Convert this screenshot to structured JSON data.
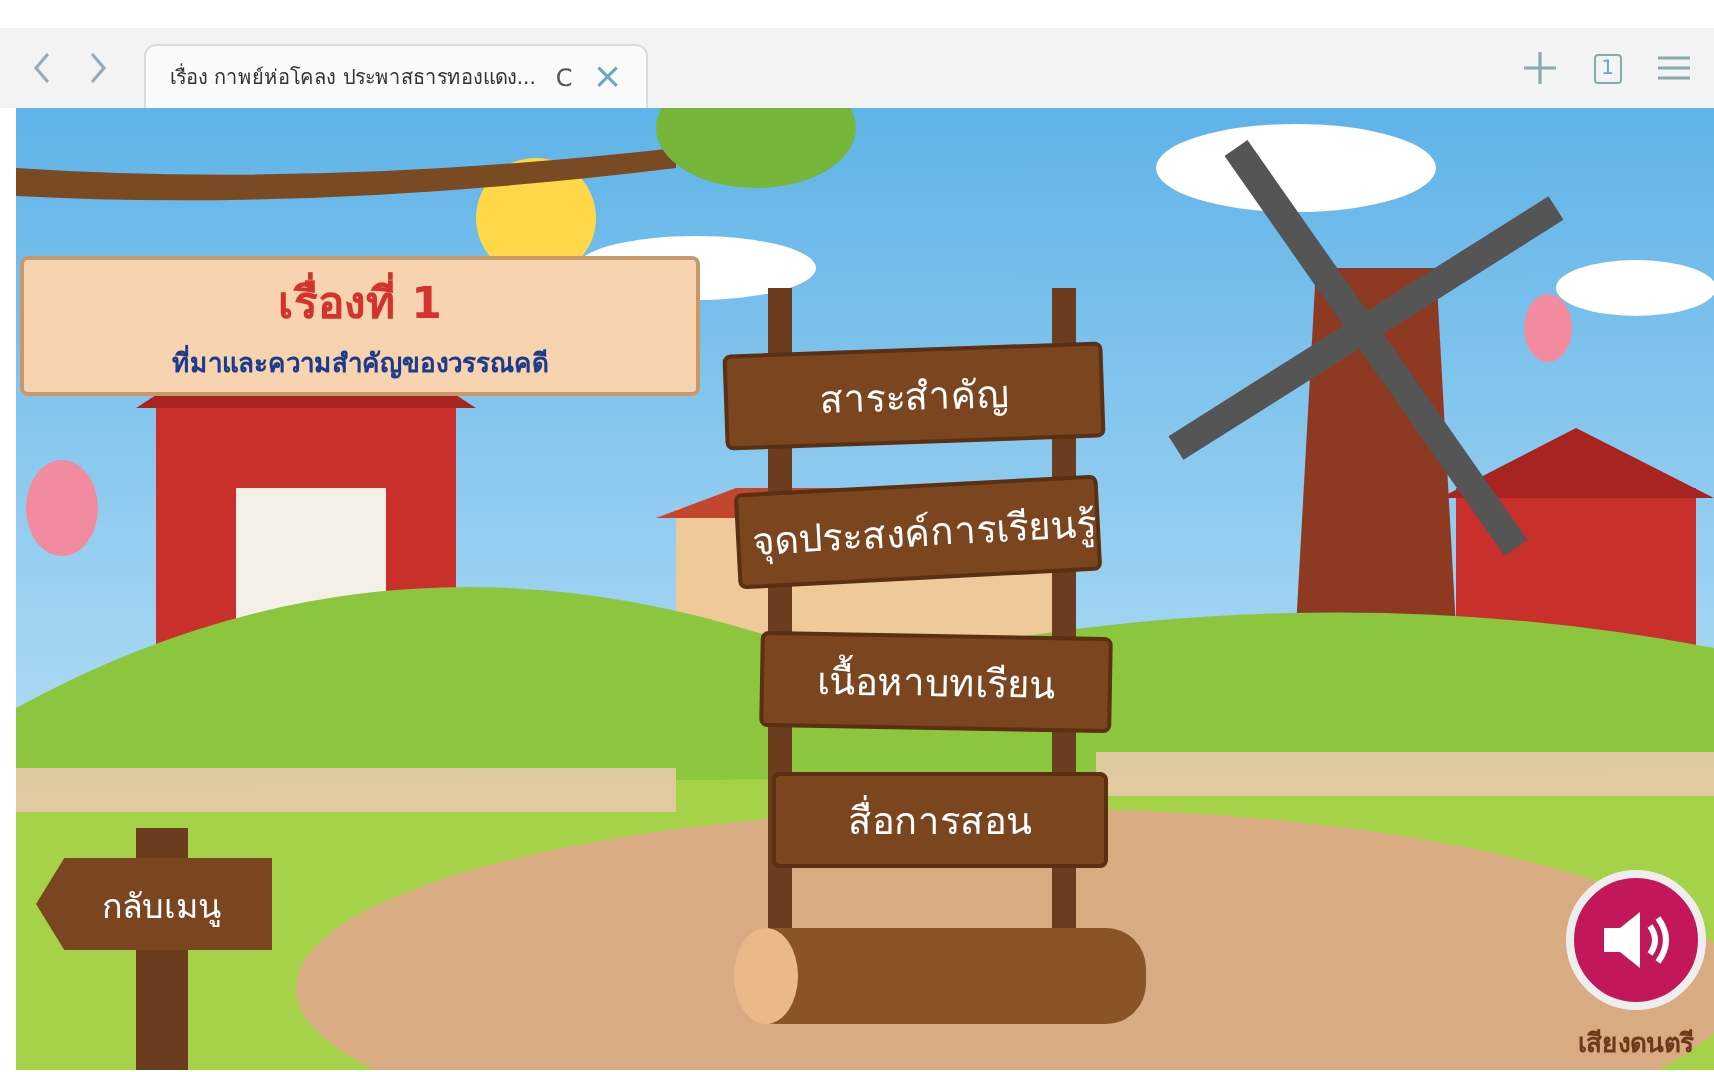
{
  "browser": {
    "tab_title": "เรื่อง กาพย์ห่อโคลง ประพาสธารทองแดง...",
    "reload": "C",
    "close": "×",
    "tab_count": "1"
  },
  "title_sign": {
    "heading": "เรื่องที่ 1",
    "subtitle": "ที่มาและความสำคัญของวรรณคดี"
  },
  "menu": [
    {
      "label": "สาระสำคัญ"
    },
    {
      "label": "จุดประสงค์การเรียนรู้"
    },
    {
      "label": "เนื้อหาบทเรียน"
    },
    {
      "label": "สื่อการสอน"
    }
  ],
  "back_sign": {
    "label": "กลับเมนู"
  },
  "music": {
    "label": "เสียงดนตรี"
  }
}
